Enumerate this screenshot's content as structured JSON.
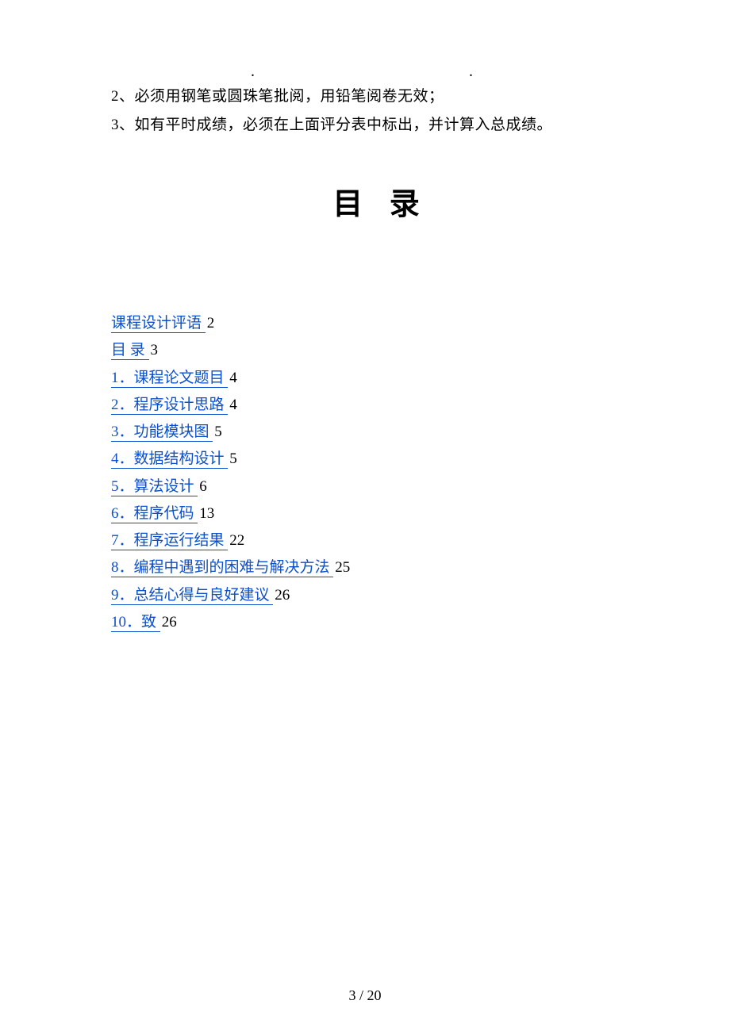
{
  "dots": {
    "d1": ".",
    "d2": "."
  },
  "instructions": [
    "2、必须用钢笔或圆珠笔批阅，用铅笔阅卷无效；",
    "3、如有平时成绩，必须在上面评分表中标出，并计算入总成绩。"
  ],
  "title": "目 录",
  "toc": [
    {
      "label": "课程设计评语 ",
      "page": "2"
    },
    {
      "label": "目  录 ",
      "page": "3"
    },
    {
      "label": "1．课程论文题目 ",
      "page": "4"
    },
    {
      "label": "2．程序设计思路 ",
      "page": "4"
    },
    {
      "label": "3．功能模块图 ",
      "page": "5"
    },
    {
      "label": "4．数据结构设计 ",
      "page": "5"
    },
    {
      "label": "5．算法设计 ",
      "page": "6"
    },
    {
      "label": "6．程序代码 ",
      "page": "13"
    },
    {
      "label": "7．程序运行结果 ",
      "page": "22"
    },
    {
      "label": "8．编程中遇到的困难与解决方法 ",
      "page": "25"
    },
    {
      "label": "9．总结心得与良好建议 ",
      "page": "26"
    },
    {
      "label": "10．致 ",
      "page": "26"
    }
  ],
  "footer": "3  /  20"
}
